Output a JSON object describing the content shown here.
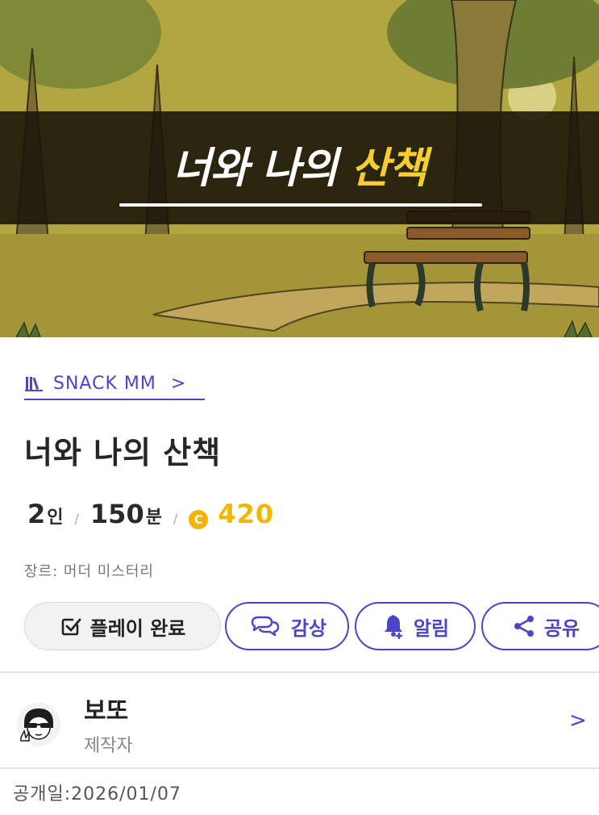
{
  "banner": {
    "title_main": "너와 나의 ",
    "title_highlight": "산책"
  },
  "brand": {
    "icon": "books-icon",
    "label": "SNACK MM",
    "chevron": ">"
  },
  "game": {
    "title": "너와 나의 산책",
    "players_num": "2",
    "players_unit": "인",
    "duration_num": "150",
    "duration_unit": "분",
    "separator": "/",
    "coin_symbol": "C",
    "price": "420",
    "genre": "장르: 머더 미스터리"
  },
  "actions": {
    "done_label": "플레이 완료",
    "review_label": "감상",
    "alarm_label": "알림",
    "share_label": "공유"
  },
  "creator": {
    "name": "보또",
    "role": "제작자",
    "chevron": ">"
  },
  "release": {
    "text": "공개일:2026/01/07"
  },
  "colors": {
    "accent": "#4b45c7",
    "coin": "#f2b600",
    "banner_highlight": "#f5cf2e"
  }
}
